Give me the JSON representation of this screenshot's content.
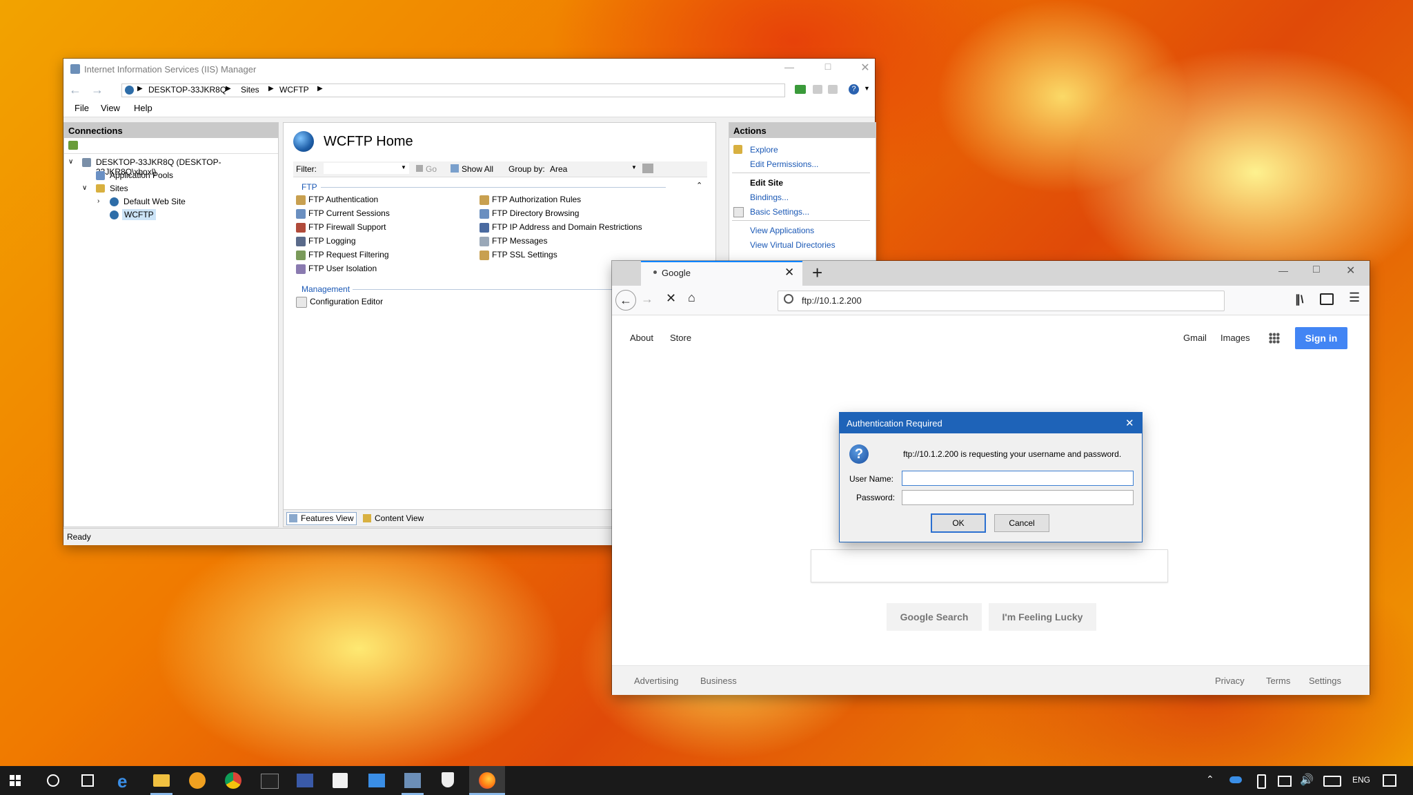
{
  "iis": {
    "title": "Internet Information Services (IIS) Manager",
    "breadcrumb": [
      "DESKTOP-33JKR8Q",
      "Sites",
      "WCFTP"
    ],
    "menu": [
      "File",
      "View",
      "Help"
    ],
    "connections": {
      "header": "Connections",
      "tree": {
        "server": "DESKTOP-33JKR8Q (DESKTOP-33JKR8Q\\xboxl)",
        "app_pools": "Application Pools",
        "sites": "Sites",
        "default_site": "Default Web Site",
        "wcftp": "WCFTP"
      }
    },
    "home": {
      "title": "WCFTP Home",
      "filter_label": "Filter:",
      "go": "Go",
      "show_all": "Show All",
      "group_by_label": "Group by:",
      "group_by_value": "Area",
      "group_ftp": "FTP",
      "ftp_col1": [
        "FTP Authentication",
        "FTP Current Sessions",
        "FTP Firewall Support",
        "FTP Logging",
        "FTP Request Filtering",
        "FTP User Isolation"
      ],
      "ftp_col2": [
        "FTP Authorization Rules",
        "FTP Directory Browsing",
        "FTP IP Address and Domain Restrictions",
        "FTP Messages",
        "FTP SSL Settings"
      ],
      "group_mgmt": "Management",
      "mgmt_items": [
        "Configuration Editor"
      ],
      "features_view": "Features View",
      "content_view": "Content View"
    },
    "actions": {
      "header": "Actions",
      "explore": "Explore",
      "edit_permissions": "Edit Permissions...",
      "edit_site": "Edit Site",
      "bindings": "Bindings...",
      "basic_settings": "Basic Settings...",
      "view_applications": "View Applications",
      "view_virtual_directories": "View Virtual Directories"
    },
    "status": "Ready"
  },
  "browser": {
    "tab_title": "Google",
    "url": "ftp://10.1.2.200",
    "nav_left": [
      "About",
      "Store"
    ],
    "nav_right": [
      "Gmail",
      "Images"
    ],
    "sign_in": "Sign in",
    "search_button": "Google Search",
    "lucky_button": "I'm Feeling Lucky",
    "footer_left": [
      "Advertising",
      "Business"
    ],
    "footer_right": [
      "Privacy",
      "Terms",
      "Settings"
    ]
  },
  "auth": {
    "title": "Authentication Required",
    "message": "ftp://10.1.2.200 is requesting your username and password.",
    "username_label": "User Name:",
    "password_label": "Password:",
    "username_value": "",
    "password_value": "",
    "ok": "OK",
    "cancel": "Cancel"
  },
  "taskbar": {
    "lang": "ENG",
    "pinned": [
      "windows-start-icon",
      "cortana-icon",
      "task-view-icon",
      "edge-icon",
      "file-explorer-icon",
      "app-icon",
      "chrome-icon",
      "terminal-icon",
      "powershell-icon",
      "store-icon",
      "remote-desktop-icon",
      "iis-icon",
      "security-icon",
      "firefox-icon"
    ]
  },
  "colors": {
    "link": "#1a58b5",
    "dialog_title": "#1e63b8",
    "sign_in": "#4285f4",
    "selection": "#cce4f7"
  }
}
